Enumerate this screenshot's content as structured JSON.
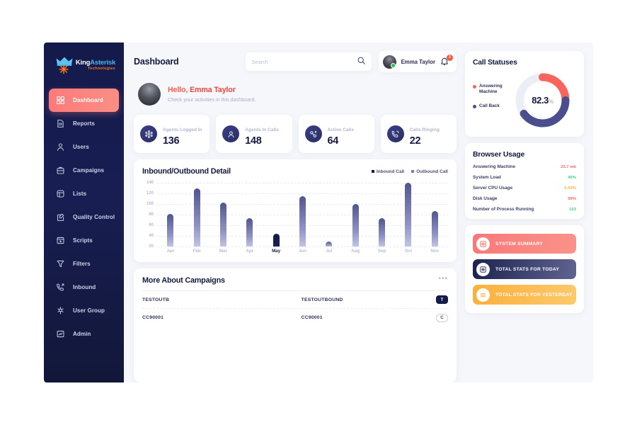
{
  "brand": {
    "name_part1": "King",
    "name_part2": "Asterisk",
    "tagline": "Technologies"
  },
  "sidebar": {
    "items": [
      {
        "label": "Dashboard",
        "icon": "grid-icon",
        "active": true
      },
      {
        "label": "Reports",
        "icon": "document-icon",
        "active": false
      },
      {
        "label": "Users",
        "icon": "user-icon",
        "active": false
      },
      {
        "label": "Campaigns",
        "icon": "briefcase-icon",
        "active": false
      },
      {
        "label": "Lists",
        "icon": "list-icon",
        "active": false
      },
      {
        "label": "Quality Control",
        "icon": "edit-square-icon",
        "active": false
      },
      {
        "label": "Scripts",
        "icon": "window-icon",
        "active": false
      },
      {
        "label": "Filters",
        "icon": "funnel-icon",
        "active": false
      },
      {
        "label": "Inbound",
        "icon": "phone-incoming-icon",
        "active": false
      },
      {
        "label": "User Group",
        "icon": "users-group-icon",
        "active": false
      },
      {
        "label": "Admin",
        "icon": "chart-square-icon",
        "active": false
      }
    ]
  },
  "header": {
    "page_title": "Dashboard",
    "search_placeholder": "Search",
    "search_value": "",
    "profile_name": "Emma Taylor",
    "notification_count": "2"
  },
  "greeting": {
    "hello": "Hello,",
    "name": "Emma Taylor",
    "subtitle": "Check your activities in this dashboard."
  },
  "stats": [
    {
      "label": "Agents Logged In",
      "value": "136",
      "icon": "agents-icon"
    },
    {
      "label": "Agents In Calls",
      "value": "148",
      "icon": "agent-call-icon"
    },
    {
      "label": "Active Calls",
      "value": "64",
      "icon": "active-call-icon"
    },
    {
      "label": "Calls Ringing",
      "value": "22",
      "icon": "ringing-phone-icon"
    }
  ],
  "chart_data": {
    "type": "bar",
    "title": "Inbound/Outbound Detail",
    "categories": [
      "Jan",
      "Feb",
      "Mar",
      "Apr",
      "May",
      "Jun",
      "Jul",
      "Aug",
      "Sep",
      "Oct",
      "Nov"
    ],
    "values": [
      81,
      130,
      103,
      73,
      44,
      115,
      30,
      100,
      74,
      140,
      87
    ],
    "highlighted_category": "May",
    "xlabel": "",
    "ylabel": "",
    "ylim": [
      20,
      140
    ],
    "yticks": [
      20,
      40,
      60,
      80,
      100,
      120,
      140
    ],
    "grid": true,
    "legend_position": "top-right",
    "legend": [
      {
        "name": "Inbound Call",
        "color": "#161c48"
      },
      {
        "name": "Outbound Call",
        "color": "#7b7fb8"
      }
    ]
  },
  "campaigns": {
    "title": "More About Campaigns",
    "menu_icon": "ellipsis-icon",
    "rows": [
      {
        "col1": "TESTOUTB",
        "col2": "TESTOUTBOUND",
        "tag": "T",
        "tag_style": "filled"
      },
      {
        "col1": "CC90001",
        "col2": "CC90001",
        "tag": "C",
        "tag_style": "outline"
      }
    ]
  },
  "call_statuses": {
    "title": "Call Statuses",
    "center_value": "82.3",
    "center_unit": "%",
    "legend": [
      {
        "label": "Answering Machine",
        "color": "#f9655c",
        "percent": 25
      },
      {
        "label": "Call Back",
        "color": "#4a4e8c",
        "percent": 40
      }
    ],
    "track_color": "#eceef5"
  },
  "browser_usage": {
    "title": "Browser Usage",
    "rows": [
      {
        "label": "Answering Machine",
        "value": "23.7 mb",
        "color": "#fa6a6a"
      },
      {
        "label": "System Load",
        "value": "45%",
        "color": "#45cf7e"
      },
      {
        "label": "Server CPU Usage",
        "value": "0.03%",
        "color": "#fbb040"
      },
      {
        "label": "Disk Usage",
        "value": "99%",
        "color": "#fa6a6a"
      },
      {
        "label": "Number of Process Running",
        "value": "103",
        "color": "#45cf7e"
      }
    ]
  },
  "action_buttons": [
    {
      "label": "SYSTEM SUMMARY",
      "icon": "list-box-icon",
      "color_from": "#fb7878",
      "color_to": "#f9938a",
      "icon_color": "#f9655c"
    },
    {
      "label": "TOTAL STATS FOR TODAY",
      "icon": "list-box-icon",
      "color_from": "#1d2350",
      "color_to": "#5f648f",
      "icon_color": "#2a2f5e"
    },
    {
      "label": "TOTAL STATS FOR YESTERDAY",
      "icon": "menu-bars-icon",
      "color_from": "#fbb03b",
      "color_to": "#fdc96a",
      "icon_color": "#fbab31"
    }
  ]
}
